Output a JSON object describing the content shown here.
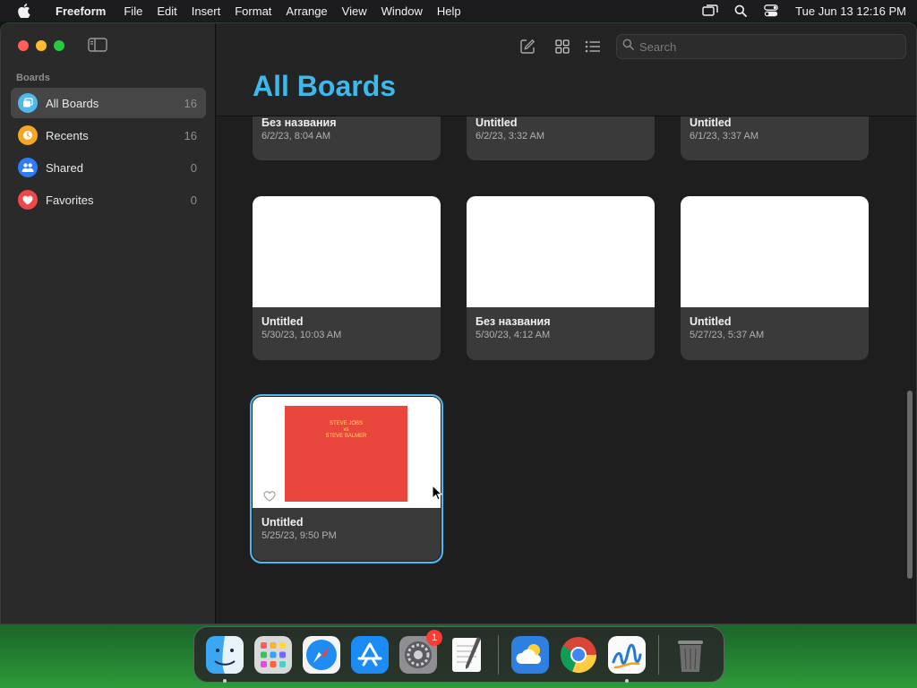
{
  "menubar": {
    "app_name": "Freeform",
    "items": [
      "File",
      "Edit",
      "Insert",
      "Format",
      "Arrange",
      "View",
      "Window",
      "Help"
    ],
    "clock": "Tue Jun 13  12:16 PM"
  },
  "sidebar": {
    "section_label": "Boards",
    "items": [
      {
        "label": "All Boards",
        "count": "16",
        "color": "#4fb9ee",
        "icon": "all-boards-icon"
      },
      {
        "label": "Recents",
        "count": "16",
        "color": "#f5a623",
        "icon": "clock-icon"
      },
      {
        "label": "Shared",
        "count": "0",
        "color": "#2f7df6",
        "icon": "people-icon"
      },
      {
        "label": "Favorites",
        "count": "0",
        "color": "#f0474a",
        "icon": "heart-icon"
      }
    ]
  },
  "toolbar": {
    "search_placeholder": "Search"
  },
  "main": {
    "title": "All Boards",
    "top_row": [
      {
        "title": "Без названия",
        "date": "6/2/23, 8:04 AM"
      },
      {
        "title": "Untitled",
        "date": "6/2/23, 3:32 AM"
      },
      {
        "title": "Untitled",
        "date": "6/1/23, 3:37 AM"
      }
    ],
    "middle_row": [
      {
        "title": "Untitled",
        "date": "5/30/23, 10:03 AM"
      },
      {
        "title": "Без названия",
        "date": "5/30/23, 4:12 AM"
      },
      {
        "title": "Untitled",
        "date": "5/27/23, 5:37 AM"
      }
    ],
    "bottom_row": [
      {
        "title": "Untitled",
        "date": "5/25/23, 9:50 PM",
        "thumb_line1": "STEVE JOBS",
        "thumb_line2": "vs",
        "thumb_line3": "STEVE BALMER"
      }
    ]
  },
  "dock": {
    "apps": [
      "Finder",
      "Launchpad",
      "Safari",
      "App Store",
      "System Settings",
      "TextEdit",
      "Weather",
      "Chrome",
      "Freeform",
      "Trash"
    ],
    "settings_badge": "1"
  },
  "colors": {
    "accent": "#3fb8ea",
    "selection": "#4fb9ee"
  }
}
